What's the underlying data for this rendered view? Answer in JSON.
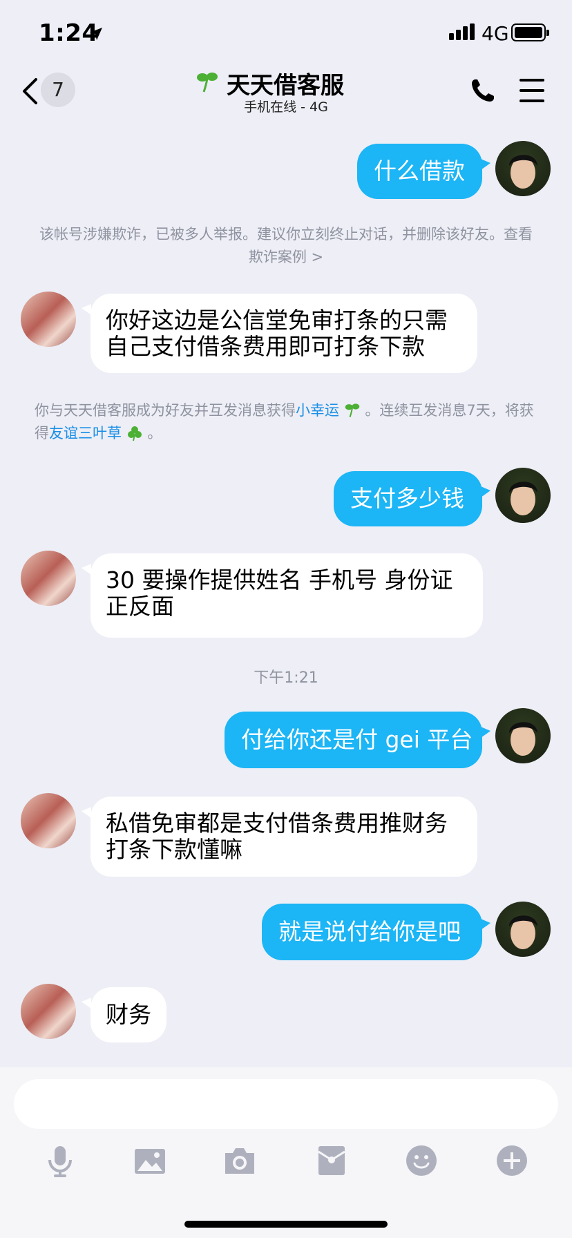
{
  "status_bar": {
    "time": "1:24",
    "network": "4G"
  },
  "header": {
    "back_count": "7",
    "title": "天天借客服",
    "subtitle": "手机在线 - 4G"
  },
  "messages": [
    {
      "from": "me",
      "text": "什么借款"
    },
    {
      "from": "system",
      "text": "该帐号涉嫌欺诈，已被多人举报。建议你立刻终止对话，并删除该好友。查看欺诈案例 >"
    },
    {
      "from": "other",
      "text": "你好这边是公信堂免审打条的只需自己支付借条费用即可打条下款"
    },
    {
      "from": "system_rich",
      "parts": [
        "你与天天借客服成为好友并互发消息获得",
        "小幸运",
        "。连续互发消息7天，将获得",
        "友谊三叶草",
        "。"
      ]
    },
    {
      "from": "me",
      "text": "支付多少钱"
    },
    {
      "from": "other",
      "text": "30  要操作提供姓名 手机号 身份证正反面"
    },
    {
      "from": "timestamp",
      "text": "下午1:21"
    },
    {
      "from": "me",
      "text": "付给你还是付 gei 平台"
    },
    {
      "from": "other",
      "text": "私借免审都是支付借条费用推财务打条下款懂嘛"
    },
    {
      "from": "me",
      "text": "就是说付给你是吧"
    },
    {
      "from": "other",
      "text": "财务"
    }
  ],
  "colors": {
    "my_bubble": "#1cb5f5",
    "background": "#edeef6",
    "highlight": "#1a8fe6"
  },
  "toolbar": {
    "icons": [
      "microphone-icon",
      "image-icon",
      "camera-icon",
      "red-packet-icon",
      "emoji-icon",
      "plus-icon"
    ]
  }
}
